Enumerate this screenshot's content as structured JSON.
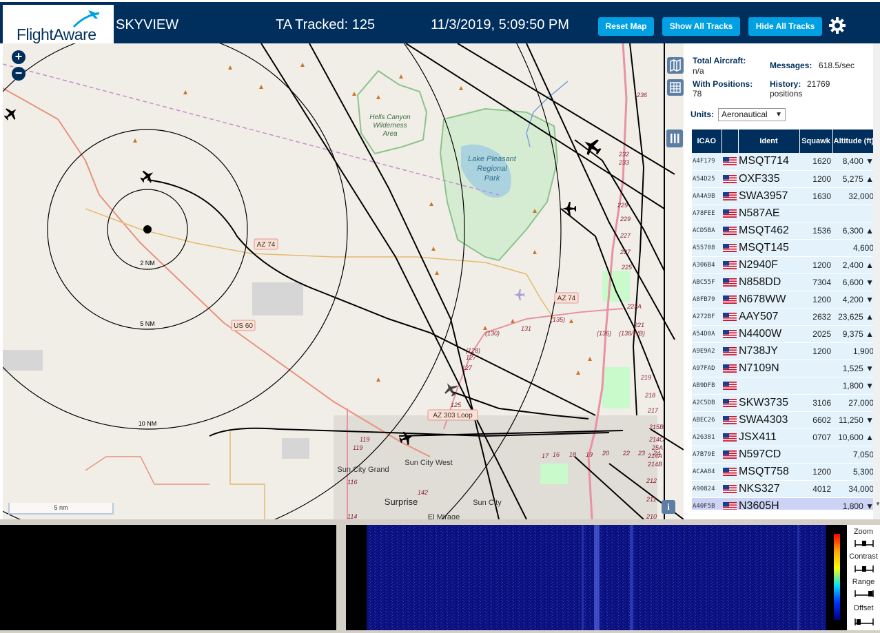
{
  "header": {
    "logo": "FlightAware",
    "app_name": "SKYVIEW",
    "ta_tracked": "TA Tracked: 125",
    "datetime": "11/3/2019, 5:09:50 PM",
    "buttons": {
      "reset_map": "Reset Map",
      "show_all": "Show All Tracks",
      "hide_all": "Hide All Tracks"
    },
    "settings_icon": "gear-icon"
  },
  "map": {
    "zoom_in": "+",
    "zoom_out": "−",
    "scale_label": "5 nm",
    "info": "i",
    "range_rings": [
      "2 NM",
      "5 NM",
      "10 NM"
    ],
    "road_labels": [
      "AZ 74",
      "AZ 74",
      "US 60",
      "AZ 303 Loop"
    ],
    "place_labels": [
      "Hells Canyon",
      "Wilderness",
      "Area",
      "Lake Pleasant",
      "Regional",
      "Park",
      "Sun City Grand",
      "Sun City West",
      "Surprise",
      "Sun City",
      "El Mirage"
    ],
    "mile_markers": [
      "236",
      "232",
      "233",
      "229",
      "229",
      "227",
      "227",
      "225",
      "223A",
      "221",
      "219",
      "218",
      "217",
      "215B",
      "214C",
      "214A",
      "214B",
      "212",
      "211",
      "210",
      "(130)",
      "(135)",
      "(136)",
      "(128)",
      "127",
      "127",
      "131",
      "125",
      "(138/WB)",
      "17",
      "16",
      "18",
      "19",
      "20",
      "22",
      "23",
      "24",
      "25A",
      "119",
      "119",
      "116",
      "114",
      "142"
    ],
    "colors": {
      "land": "#f1eee8",
      "water": "#aad3df",
      "park": "#c8facc",
      "park_border": "#8bc38b",
      "highway": "#e8927c",
      "primary": "#e6b96a",
      "freeway": "#e892a2"
    }
  },
  "stats": {
    "total_aircraft_label": "Total Aircraft:",
    "total_aircraft": "n/a",
    "with_positions_label": "With Positions:",
    "with_positions": "78",
    "messages_label": "Messages:",
    "messages": "618.5/sec",
    "history_label": "History:",
    "history": "21769",
    "history_unit": "positions",
    "units_label": "Units:",
    "units_value": "Aeronautical"
  },
  "table": {
    "headers": [
      "ICAO",
      "",
      "Ident",
      "Squawk",
      "Altitude (ft)"
    ],
    "rows": [
      {
        "icao": "A4F179",
        "ident": "MSQT714",
        "squawk": "1620",
        "alt": "8,400 ▼"
      },
      {
        "icao": "A54D25",
        "ident": "OXF335",
        "squawk": "1200",
        "alt": "5,275 ▲"
      },
      {
        "icao": "AA4A9B",
        "ident": "SWA3957",
        "squawk": "1630",
        "alt": "32,000"
      },
      {
        "icao": "A78FEE",
        "ident": "N587AE",
        "squawk": "",
        "alt": ""
      },
      {
        "icao": "ACD5BA",
        "ident": "MSQT462",
        "squawk": "1536",
        "alt": "6,300 ▲"
      },
      {
        "icao": "A55708",
        "ident": "MSQT145",
        "squawk": "",
        "alt": "4,600"
      },
      {
        "icao": "A306B4",
        "ident": "N2940F",
        "squawk": "1200",
        "alt": "2,400 ▲"
      },
      {
        "icao": "ABC55F",
        "ident": "N858DD",
        "squawk": "7304",
        "alt": "6,600 ▼"
      },
      {
        "icao": "A8FB79",
        "ident": "N678WW",
        "squawk": "1200",
        "alt": "4,200 ▼"
      },
      {
        "icao": "A272BF",
        "ident": "AAY507",
        "squawk": "2632",
        "alt": "23,625 ▲"
      },
      {
        "icao": "A54D0A",
        "ident": "N4400W",
        "squawk": "2025",
        "alt": "9,375 ▲"
      },
      {
        "icao": "A9E9A2",
        "ident": "N738JY",
        "squawk": "1200",
        "alt": "1,900"
      },
      {
        "icao": "A97FAD",
        "ident": "N7109N",
        "squawk": "",
        "alt": "1,525 ▼"
      },
      {
        "icao": "AB9DFB",
        "ident": "",
        "squawk": "",
        "alt": "1,800 ▼"
      },
      {
        "icao": "A2C5DB",
        "ident": "SKW3735",
        "squawk": "3106",
        "alt": "27,000"
      },
      {
        "icao": "ABEC26",
        "ident": "SWA4303",
        "squawk": "6602",
        "alt": "11,250 ▼"
      },
      {
        "icao": "A26381",
        "ident": "JSX411",
        "squawk": "0707",
        "alt": "10,600 ▲"
      },
      {
        "icao": "A7B79E",
        "ident": "N597CD",
        "squawk": "",
        "alt": "7,050"
      },
      {
        "icao": "ACAA84",
        "ident": "MSQT758",
        "squawk": "1200",
        "alt": "5,300"
      },
      {
        "icao": "A90824",
        "ident": "NKS327",
        "squawk": "4012",
        "alt": "34,000"
      },
      {
        "icao": "A40F5B",
        "ident": "N3605H",
        "squawk": "",
        "alt": "1,800 ▼"
      }
    ]
  },
  "bottom": {
    "controls": [
      "Zoom",
      "Contrast",
      "Range",
      "Offset"
    ]
  }
}
